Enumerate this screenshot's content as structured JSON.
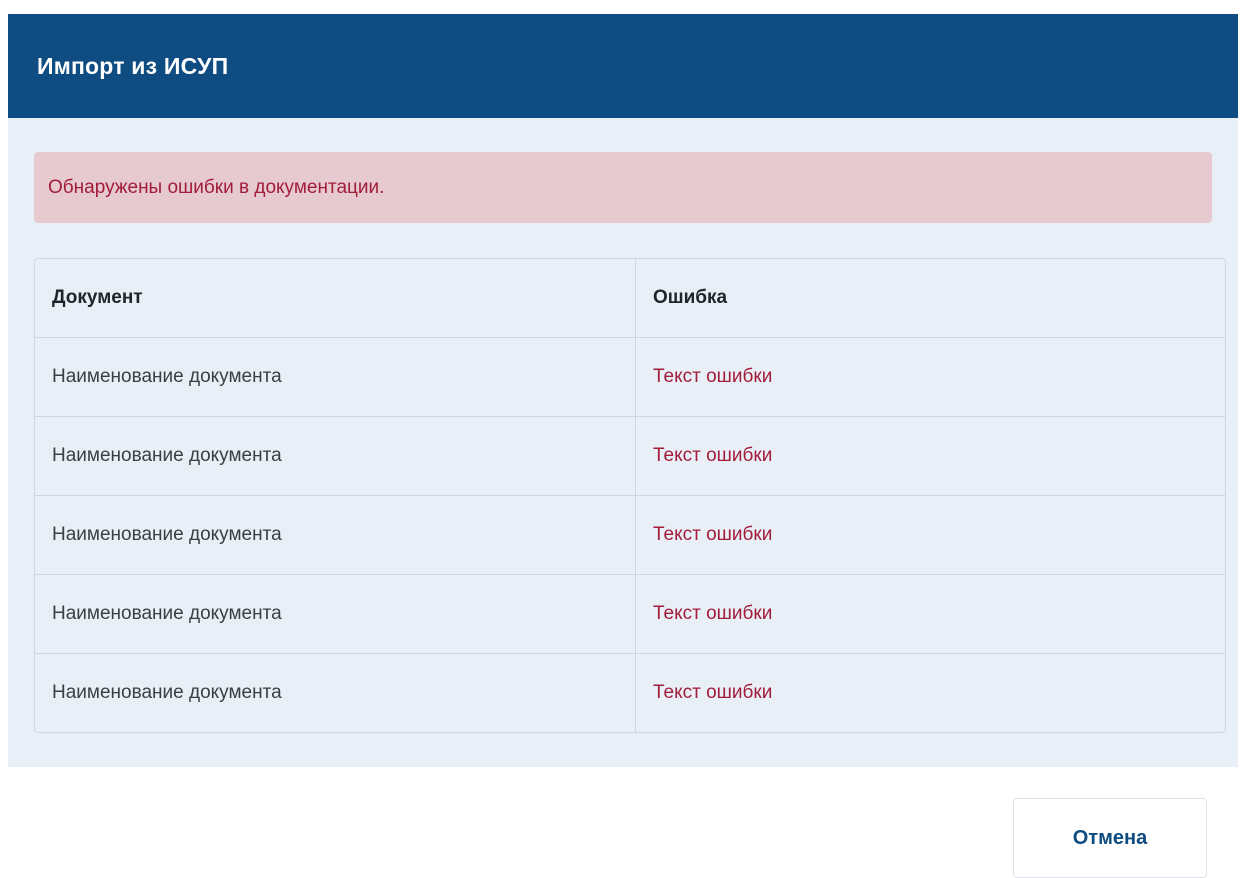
{
  "dialog": {
    "title": "Импорт из ИСУП"
  },
  "alert": {
    "message": "Обнаружены ошибки в документации."
  },
  "table": {
    "columns": [
      "Документ",
      "Ошибка"
    ],
    "rows": [
      {
        "document": "Наименование документа",
        "error": "Текст ошибки"
      },
      {
        "document": "Наименование документа",
        "error": "Текст ошибки"
      },
      {
        "document": "Наименование документа",
        "error": "Текст ошибки"
      },
      {
        "document": "Наименование документа",
        "error": "Текст ошибки"
      },
      {
        "document": "Наименование документа",
        "error": "Текст ошибки"
      }
    ]
  },
  "footer": {
    "cancel_label": "Отмена"
  },
  "colors": {
    "header_bg": "#0f4c81",
    "body_bg": "#e9eff7",
    "alert_bg": "#e7c9d0",
    "error_text": "#a11d3a"
  }
}
